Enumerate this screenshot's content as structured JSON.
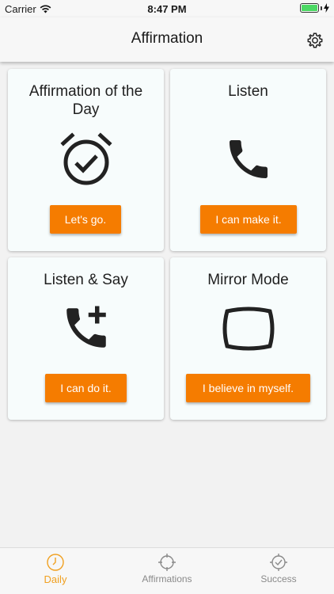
{
  "status_bar": {
    "carrier": "Carrier",
    "time": "8:47 PM"
  },
  "nav": {
    "title": "Affirmation",
    "settings_icon": "gear-icon"
  },
  "cards": [
    {
      "title": "Affirmation of the Day",
      "icon": "alarm-clock-check-icon",
      "button": "Let's go."
    },
    {
      "title": "Listen",
      "icon": "phone-icon",
      "button": "I can make it."
    },
    {
      "title": "Listen & Say",
      "icon": "phone-add-icon",
      "button": "I can do it."
    },
    {
      "title": "Mirror Mode",
      "icon": "mirror-screen-icon",
      "button": "I believe in myself."
    }
  ],
  "tabs": [
    {
      "label": "Daily",
      "icon": "clock-icon",
      "active": true
    },
    {
      "label": "Affirmations",
      "icon": "crosshair-icon",
      "active": false
    },
    {
      "label": "Success",
      "icon": "check-target-icon",
      "active": false
    }
  ],
  "colors": {
    "accent": "#f57c00",
    "active_tab": "#f0a020",
    "card_background": "#f7fcfc",
    "page_background": "#f2f2f2"
  }
}
